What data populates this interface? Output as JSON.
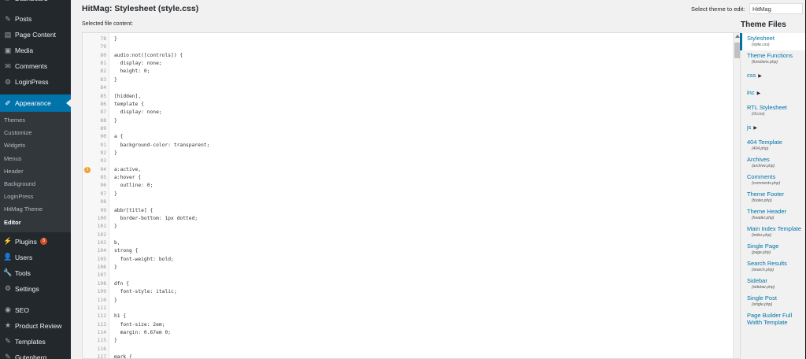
{
  "sidebar": {
    "top_items": [
      {
        "label": "Dashboard",
        "icon": "dashboard-icon",
        "glyph": "▰"
      },
      {
        "label": "Posts",
        "icon": "pin-icon",
        "glyph": "✎"
      },
      {
        "label": "Page Content",
        "icon": "page-content-icon",
        "glyph": "▤"
      },
      {
        "label": "Media",
        "icon": "media-icon",
        "glyph": "▣"
      },
      {
        "label": "Comments",
        "icon": "comments-icon",
        "glyph": "✉"
      },
      {
        "label": "LoginPress",
        "icon": "gear-icon",
        "glyph": "⚙"
      }
    ],
    "appearance": {
      "label": "Appearance",
      "icon": "paintbrush-icon",
      "glyph": "✐"
    },
    "submenu": [
      {
        "label": "Themes"
      },
      {
        "label": "Customize"
      },
      {
        "label": "Widgets"
      },
      {
        "label": "Menus"
      },
      {
        "label": "Header"
      },
      {
        "label": "Background"
      },
      {
        "label": "LoginPress"
      },
      {
        "label": "HitMag Theme"
      },
      {
        "label": "Editor",
        "current": true
      }
    ],
    "bottom_items": [
      {
        "label": "Plugins",
        "icon": "plugins-icon",
        "glyph": "⚡",
        "badge": "3"
      },
      {
        "label": "Users",
        "icon": "users-icon",
        "glyph": "👤"
      },
      {
        "label": "Tools",
        "icon": "tools-icon",
        "glyph": "🔧"
      },
      {
        "label": "Settings",
        "icon": "settings-icon",
        "glyph": "⚙"
      }
    ],
    "extra_items": [
      {
        "label": "SEO",
        "icon": "seo-icon",
        "glyph": "◉"
      },
      {
        "label": "Product Review",
        "icon": "product-review-icon",
        "glyph": "★"
      },
      {
        "label": "Templates",
        "icon": "templates-icon",
        "glyph": "✎"
      },
      {
        "label": "Gutenberg",
        "icon": "gutenberg-icon",
        "glyph": "✎"
      }
    ]
  },
  "header": {
    "title": "HitMag: Stylesheet (style.css)",
    "select_label": "Select theme to edit:",
    "select_value": "HitMag"
  },
  "editor": {
    "label": "Selected file content:",
    "lines": [
      {
        "n": "78",
        "t": "}"
      },
      {
        "n": "79",
        "t": ""
      },
      {
        "n": "80",
        "t": "audio:not([controls]) {"
      },
      {
        "n": "81",
        "t": "  display: none;"
      },
      {
        "n": "82",
        "t": "  height: 0;"
      },
      {
        "n": "83",
        "t": "}"
      },
      {
        "n": "84",
        "t": ""
      },
      {
        "n": "85",
        "t": "[hidden],"
      },
      {
        "n": "86",
        "t": "template {"
      },
      {
        "n": "87",
        "t": "  display: none;"
      },
      {
        "n": "88",
        "t": "}"
      },
      {
        "n": "89",
        "t": ""
      },
      {
        "n": "90",
        "t": "a {"
      },
      {
        "n": "91",
        "t": "  background-color: transparent;"
      },
      {
        "n": "92",
        "t": "}"
      },
      {
        "n": "93",
        "t": ""
      },
      {
        "n": "94",
        "t": "a:active,",
        "warn": true
      },
      {
        "n": "95",
        "t": "a:hover {"
      },
      {
        "n": "96",
        "t": "  outline: 0;"
      },
      {
        "n": "97",
        "t": "}"
      },
      {
        "n": "98",
        "t": ""
      },
      {
        "n": "99",
        "t": "abbr[title] {"
      },
      {
        "n": "100",
        "t": "  border-bottom: 1px dotted;"
      },
      {
        "n": "101",
        "t": "}"
      },
      {
        "n": "102",
        "t": ""
      },
      {
        "n": "103",
        "t": "b,"
      },
      {
        "n": "104",
        "t": "strong {"
      },
      {
        "n": "105",
        "t": "  font-weight: bold;"
      },
      {
        "n": "106",
        "t": "}"
      },
      {
        "n": "107",
        "t": ""
      },
      {
        "n": "108",
        "t": "dfn {"
      },
      {
        "n": "109",
        "t": "  font-style: italic;"
      },
      {
        "n": "110",
        "t": "}"
      },
      {
        "n": "111",
        "t": ""
      },
      {
        "n": "112",
        "t": "h1 {"
      },
      {
        "n": "113",
        "t": "  font-size: 2em;"
      },
      {
        "n": "114",
        "t": "  margin: 0.67em 0;"
      },
      {
        "n": "115",
        "t": "}"
      },
      {
        "n": "116",
        "t": ""
      },
      {
        "n": "117",
        "t": "mark {"
      }
    ]
  },
  "theme_files": {
    "heading": "Theme Files",
    "entries": [
      {
        "type": "file",
        "name": "Stylesheet",
        "path": "(style.css)",
        "current": true
      },
      {
        "type": "file",
        "name": "Theme Functions",
        "path": "(functions.php)"
      },
      {
        "type": "folder",
        "name": "css"
      },
      {
        "type": "folder",
        "name": "inc"
      },
      {
        "type": "file",
        "name": "RTL Stylesheet",
        "path": "(rtl.css)"
      },
      {
        "type": "folder",
        "name": "js"
      },
      {
        "type": "file",
        "name": "404 Template",
        "path": "(404.php)"
      },
      {
        "type": "file",
        "name": "Archives",
        "path": "(archive.php)"
      },
      {
        "type": "file",
        "name": "Comments",
        "path": "(comments.php)"
      },
      {
        "type": "file",
        "name": "Theme Footer",
        "path": "(footer.php)"
      },
      {
        "type": "file",
        "name": "Theme Header",
        "path": "(header.php)"
      },
      {
        "type": "file",
        "name": "Main Index Template",
        "path": "(index.php)"
      },
      {
        "type": "file",
        "name": "Single Page",
        "path": "(page.php)"
      },
      {
        "type": "file",
        "name": "Search Results",
        "path": "(search.php)"
      },
      {
        "type": "file",
        "name": "Sidebar",
        "path": "(sidebar.php)"
      },
      {
        "type": "file",
        "name": "Single Post",
        "path": "(single.php)"
      },
      {
        "type": "file",
        "name": "Page Builder Full Width Template",
        "path": ""
      }
    ]
  },
  "colors": {
    "sidebar_bg": "#23282d",
    "accent": "#0073aa",
    "badge": "#d54e21",
    "warning": "#f0a030"
  }
}
